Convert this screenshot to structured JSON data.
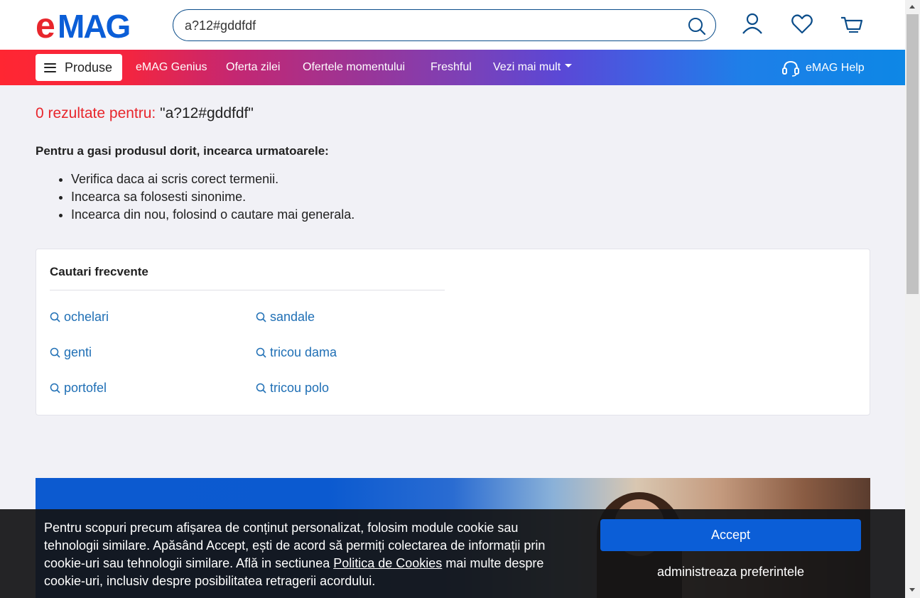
{
  "header": {
    "logo_text": "eMAG",
    "search_value": "a?12#gddfdf",
    "icons": [
      "search-icon",
      "user-icon",
      "heart-icon",
      "cart-icon"
    ]
  },
  "nav": {
    "products_label": "Produse",
    "links": [
      "eMAG Genius",
      "Oferta zilei",
      "Ofertele momentului",
      "Freshful",
      "Vezi mai mult"
    ],
    "help_label": "eMAG Help"
  },
  "results": {
    "count_label": "0 rezultate pentru:",
    "query_label": "\"a?12#gddfdf\""
  },
  "tips": {
    "title": "Pentru a gasi produsul dorit, incearca urmatoarele:",
    "items": [
      "Verifica daca ai scris corect termenii.",
      "Incearca sa folosesti sinonime.",
      "Incearca din nou, folosind o cautare mai generala."
    ]
  },
  "frequent": {
    "title": "Cautari frecvente",
    "items": [
      "ochelari",
      "sandale",
      "genti",
      "tricou dama",
      "portofel",
      "tricou polo"
    ]
  },
  "cookie": {
    "text_before_link": "Pentru scopuri precum afișarea de conținut personalizat, folosim module cookie sau tehnologii similare. Apăsând Accept, ești de acord să permiți colectarea de informații prin cookie-uri sau tehnologii similare. Află in sectiunea ",
    "link_text": "Politica de Cookies",
    "text_after_link": " mai multe despre cookie-uri, inclusiv despre posibilitatea retragerii acordului.",
    "accept_label": "Accept",
    "manage_label": "administreaza preferintele"
  },
  "colors": {
    "brand_red": "#e8262c",
    "brand_blue": "#0b5ed7",
    "link_blue": "#1f6fb5"
  }
}
